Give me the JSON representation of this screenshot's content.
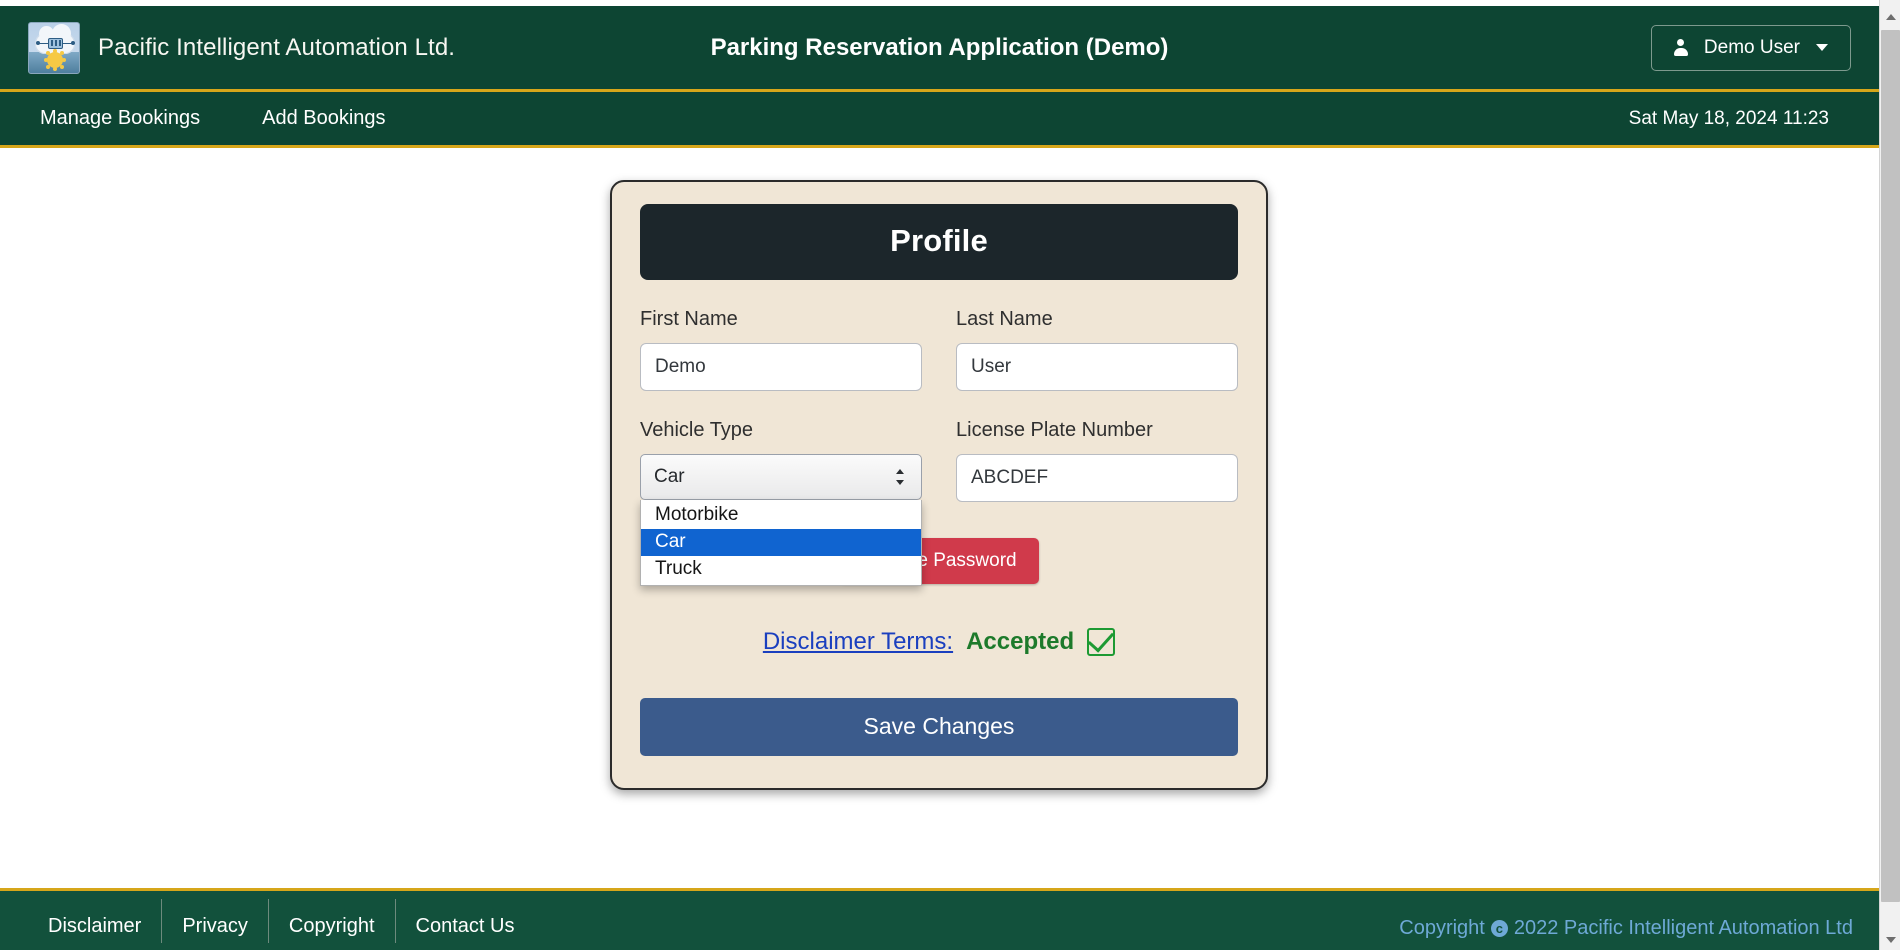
{
  "header": {
    "brand_name": "Pacific Intelligent Automation Ltd.",
    "logo_icon": "cloud-ai-sun-logo-icon",
    "app_title": "Parking Reservation Application (Demo)",
    "user_menu": {
      "label": "Demo User",
      "user_icon": "user-icon",
      "caret_icon": "chevron-down-icon"
    }
  },
  "nav": {
    "items": [
      {
        "label": "Manage Bookings"
      },
      {
        "label": "Add Bookings"
      }
    ],
    "datetime": "Sat May 18, 2024 11:23"
  },
  "profile": {
    "title": "Profile",
    "first_name": {
      "label": "First Name",
      "value": "Demo",
      "placeholder": "First Name"
    },
    "last_name": {
      "label": "Last Name",
      "value": "User",
      "placeholder": "Last Name"
    },
    "vehicle_type": {
      "label": "Vehicle Type",
      "selected": "Car",
      "options": [
        "Motorbike",
        "Car",
        "Truck"
      ],
      "expanded": true,
      "arrow_icon": "updown-arrows-icon"
    },
    "license_plate": {
      "label": "License Plate Number",
      "value": "ABCDEF",
      "placeholder": "License Plate Number"
    },
    "change_password_label": "Change Password",
    "disclaimer": {
      "link_text": "Disclaimer Terms:",
      "status_text": "Accepted",
      "check_icon": "checked-checkbox-icon"
    },
    "save_label": "Save Changes"
  },
  "footer": {
    "links": [
      {
        "label": "Disclaimer"
      },
      {
        "label": "Privacy"
      },
      {
        "label": "Copyright"
      },
      {
        "label": "Contact Us"
      }
    ],
    "copyright_prefix": "Copyright",
    "copyright_symbol": "c",
    "copyright_text": "2022 Pacific Intelligent Automation Ltd"
  },
  "scrollbar": {
    "up_icon": "scroll-up-arrow-icon",
    "down_icon": "scroll-down-arrow-icon"
  },
  "colors": {
    "header_green": "#0d4533",
    "footer_green": "#12513c",
    "gold_rule": "#d6a61a",
    "card_beige": "#f0e6d6",
    "card_title_dark": "#1c262b",
    "danger_red": "#d03a4b",
    "primary_blue": "#3b5b8c",
    "option_highlight": "#1064d0",
    "accepted_green": "#1d7a2b",
    "link_blue": "#1a3fbf"
  }
}
